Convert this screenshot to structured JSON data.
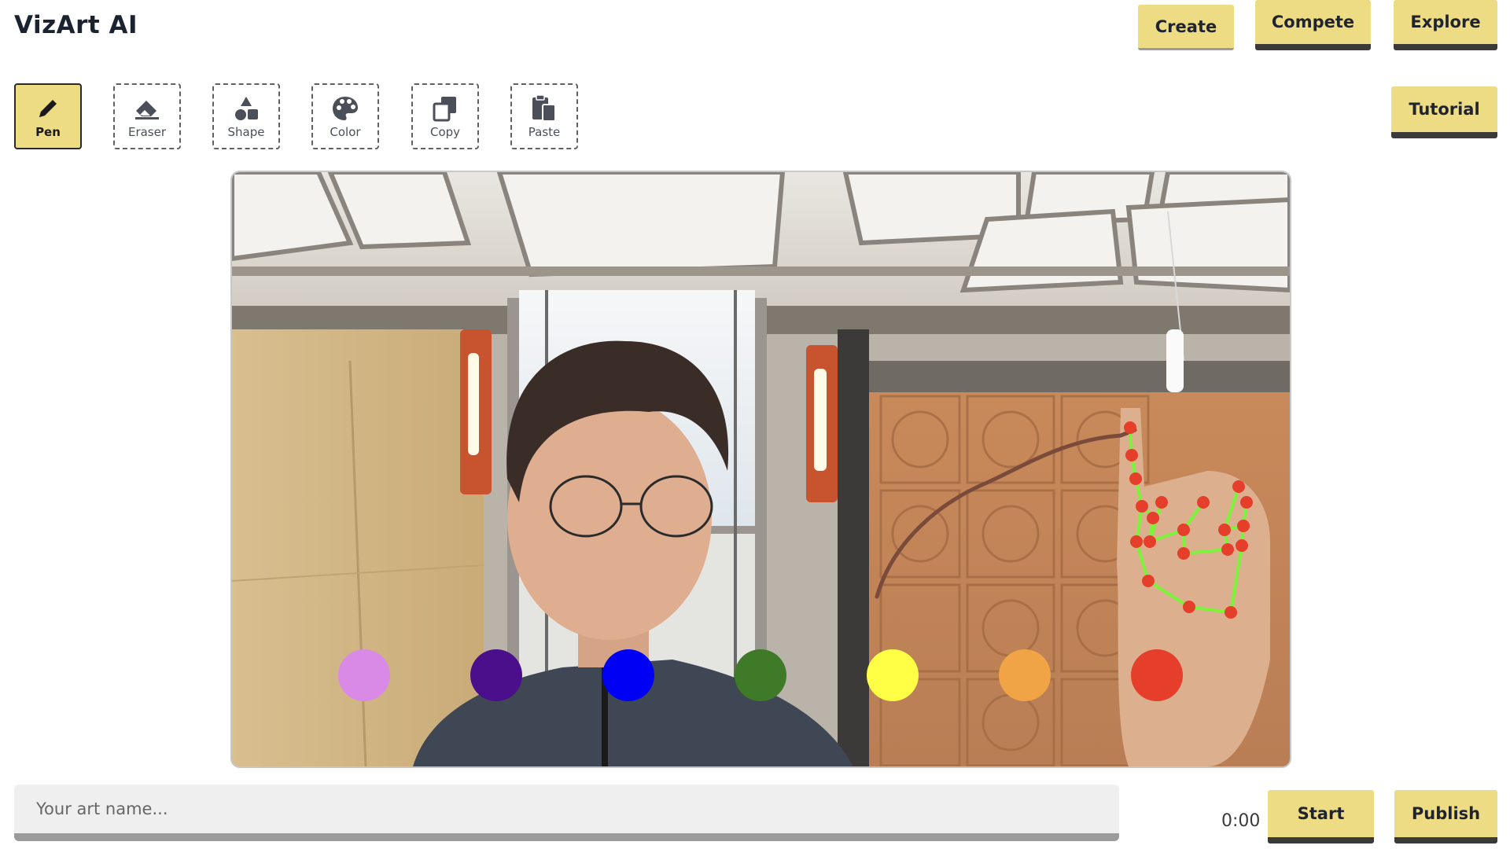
{
  "app": {
    "title": "VizArt AI"
  },
  "nav": {
    "create": "Create",
    "compete": "Compete",
    "explore": "Explore"
  },
  "tutorial": "Tutorial",
  "tools": [
    {
      "label": "Pen",
      "icon": "pencil-icon",
      "active": true
    },
    {
      "label": "Eraser",
      "icon": "eraser-icon",
      "active": false
    },
    {
      "label": "Shape",
      "icon": "shapes-icon",
      "active": false
    },
    {
      "label": "Color",
      "icon": "palette-icon",
      "active": false
    },
    {
      "label": "Copy",
      "icon": "copy-icon",
      "active": false
    },
    {
      "label": "Paste",
      "icon": "paste-icon",
      "active": false
    }
  ],
  "camera": {
    "palette": [
      {
        "name": "violet",
        "hex": "#d98ae6"
      },
      {
        "name": "indigo",
        "hex": "#4b0f8c"
      },
      {
        "name": "blue",
        "hex": "#0000f5"
      },
      {
        "name": "green",
        "hex": "#3e7a27"
      },
      {
        "name": "yellow",
        "hex": "#ffff45"
      },
      {
        "name": "orange",
        "hex": "#f0a445"
      },
      {
        "name": "red",
        "hex": "#e53e2a"
      }
    ],
    "stroke_color": "#7a4a3a",
    "hand_landmark_color": "#e53e2a",
    "hand_connection_color": "#7cf23a"
  },
  "art_name": {
    "placeholder": "Your art name...",
    "value": ""
  },
  "timer": "0:00",
  "actions": {
    "start": "Start",
    "publish": "Publish"
  }
}
